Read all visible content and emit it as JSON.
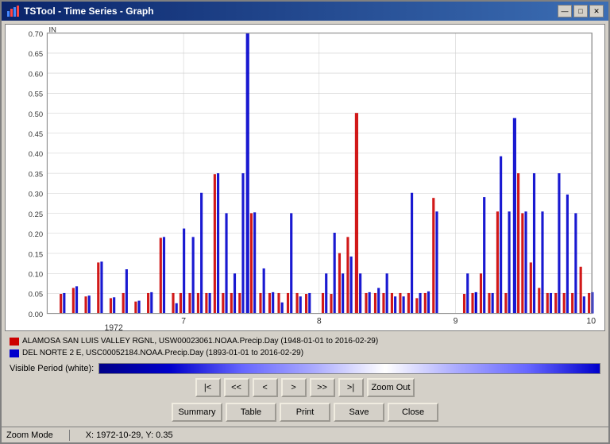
{
  "window": {
    "title": "TSTool - Time Series - Graph",
    "icon": "chart-icon"
  },
  "titleControls": {
    "minimize": "—",
    "maximize": "□",
    "close": "✕"
  },
  "chart": {
    "yAxis": {
      "label": "IN",
      "ticks": [
        "0.70",
        "0.65",
        "0.60",
        "0.55",
        "0.50",
        "0.45",
        "0.40",
        "0.35",
        "0.30",
        "0.25",
        "0.20",
        "0.15",
        "0.10",
        "0.05",
        "0.00"
      ]
    },
    "xAxis": {
      "labels": [
        "7",
        "8",
        "9",
        "10"
      ],
      "sublabel": "1972"
    }
  },
  "legend": {
    "item1": {
      "color": "#cc0000",
      "text": "ALAMOSA SAN LUIS VALLEY RGNL, USW00023061.NOAA.Precip.Day (1948-01-01 to 2016-02-29)"
    },
    "item2": {
      "color": "#0000cc",
      "text": "DEL NORTE 2 E, USC00052184.NOAA.Precip.Day (1893-01-01 to 2016-02-29)"
    }
  },
  "visiblePeriod": {
    "label": "Visible Period (white):"
  },
  "navButtons": {
    "first": "|<",
    "prev2": "<<",
    "prev": "<",
    "next": ">",
    "next2": ">>",
    "last": ">|",
    "zoomOut": "Zoom Out"
  },
  "actionButtons": {
    "summary": "Summary",
    "table": "Table",
    "print": "Print",
    "save": "Save",
    "close": "Close"
  },
  "statusBar": {
    "mode": "Zoom Mode",
    "coordinates": "X: 1972-10-29, Y: 0.35"
  }
}
